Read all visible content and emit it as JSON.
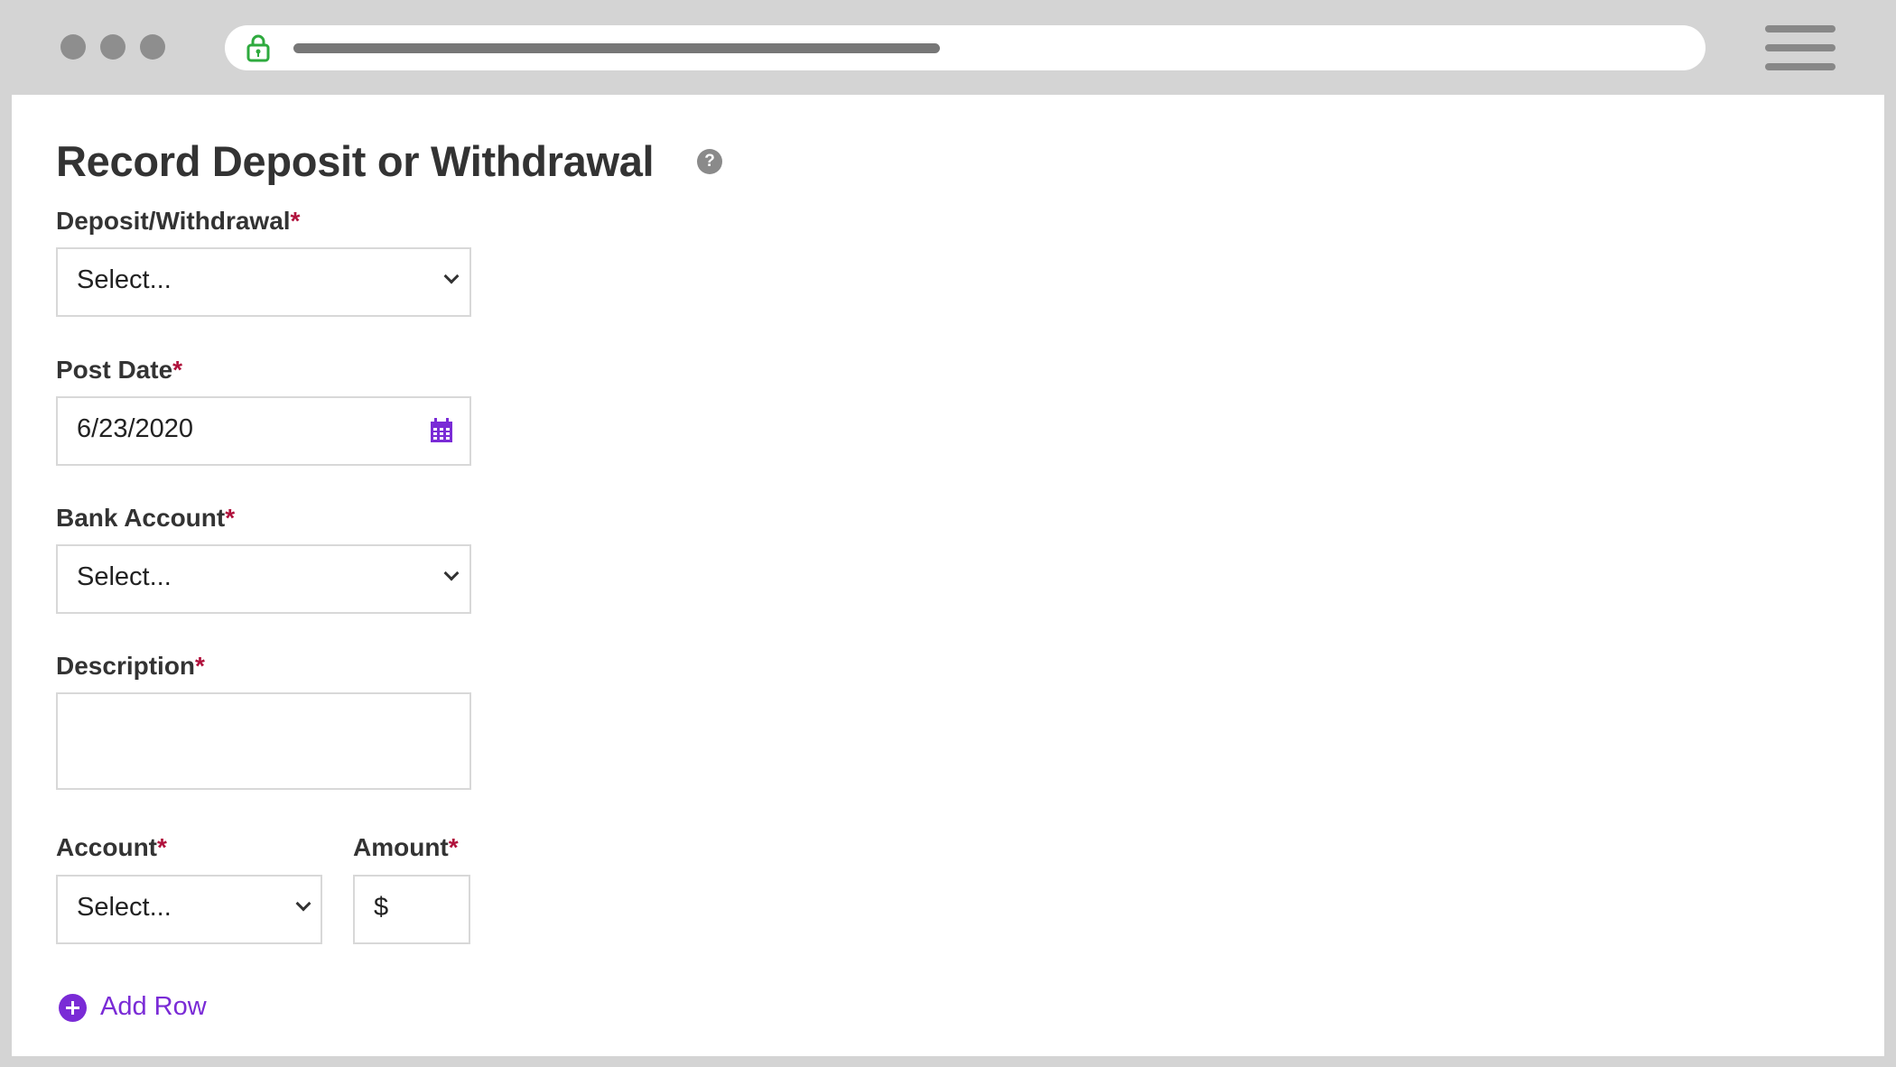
{
  "browser": {
    "window_controls": [
      "close-dot",
      "minimize-dot",
      "maximize-dot"
    ],
    "lock_icon": "lock-icon",
    "lock_color": "#2eaa3e",
    "menu_icon": "hamburger-menu-icon"
  },
  "page": {
    "title": "Record Deposit or Withdrawal",
    "help_icon_glyph": "?"
  },
  "form": {
    "required_mark": "*",
    "deposit_withdrawal": {
      "label": "Deposit/Withdrawal",
      "value": "Select..."
    },
    "post_date": {
      "label": "Post Date",
      "value": "6/23/2020",
      "icon": "calendar-icon"
    },
    "bank_account": {
      "label": "Bank Account",
      "value": "Select..."
    },
    "description": {
      "label": "Description",
      "value": ""
    },
    "account": {
      "label": "Account",
      "value": "Select..."
    },
    "amount": {
      "label": "Amount",
      "prefix": "$",
      "value": ""
    },
    "add_row": {
      "label": "Add Row",
      "icon": "plus-circle-icon"
    }
  },
  "colors": {
    "accent": "#7a2bd6",
    "required": "#b0113c",
    "text": "#333333"
  }
}
